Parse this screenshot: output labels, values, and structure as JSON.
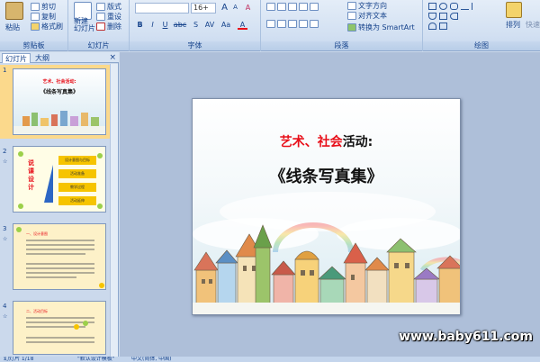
{
  "ribbon": {
    "clipboard": {
      "label": "剪贴板",
      "paste": "粘贴",
      "cut": "剪切",
      "copy": "复制",
      "format_painter": "格式刷"
    },
    "slides": {
      "label": "幻灯片",
      "new_slide_line1": "新建",
      "new_slide_line2": "幻灯片",
      "layout": "版式",
      "reset": "重设",
      "delete": "删除"
    },
    "font": {
      "label": "字体",
      "font_name": "",
      "font_size": "16+",
      "bold": "B",
      "italic": "I",
      "underline": "U",
      "strike": "abc",
      "shadow": "S",
      "spacing": "AV",
      "case": "Aa",
      "color": "A",
      "grow": "A",
      "shrink": "A",
      "clear": "A"
    },
    "paragraph": {
      "label": "段落",
      "text_direction": "文字方向",
      "align_text": "对齐文本",
      "smartart": "转换为 SmartArt"
    },
    "drawing": {
      "label": "绘图",
      "arrange": "排列",
      "quick_styles": "快速"
    }
  },
  "left_panel": {
    "tab_slides": "幻灯片",
    "tab_outline": "大纲",
    "close": "×",
    "thumbnails": [
      {
        "num": "1",
        "title_small": "艺术、社会活动:",
        "subtitle_small": "《线条写真集》"
      },
      {
        "num": "2",
        "side_text": "说课设计",
        "items": [
          "设计意图与目标",
          "活动准备",
          "教学过程",
          "活动延伸"
        ]
      },
      {
        "num": "3",
        "heading": "一、设计意图"
      },
      {
        "num": "4",
        "heading": "二、活动目标"
      }
    ]
  },
  "slide": {
    "title_line1_part1": "艺术、",
    "title_line1_part2": "社会",
    "title_line1_part3": "活动:",
    "title_line2": "《线条写真集》",
    "watermark": "www.baby611.com",
    "colors": {
      "red": "#e8101a",
      "black": "#111111",
      "sky": "#dfeef6"
    }
  },
  "status": {
    "page": "幻灯片 1/18",
    "theme": "\"默认设计模板\"",
    "lang": "中文(简体, 中国)"
  }
}
